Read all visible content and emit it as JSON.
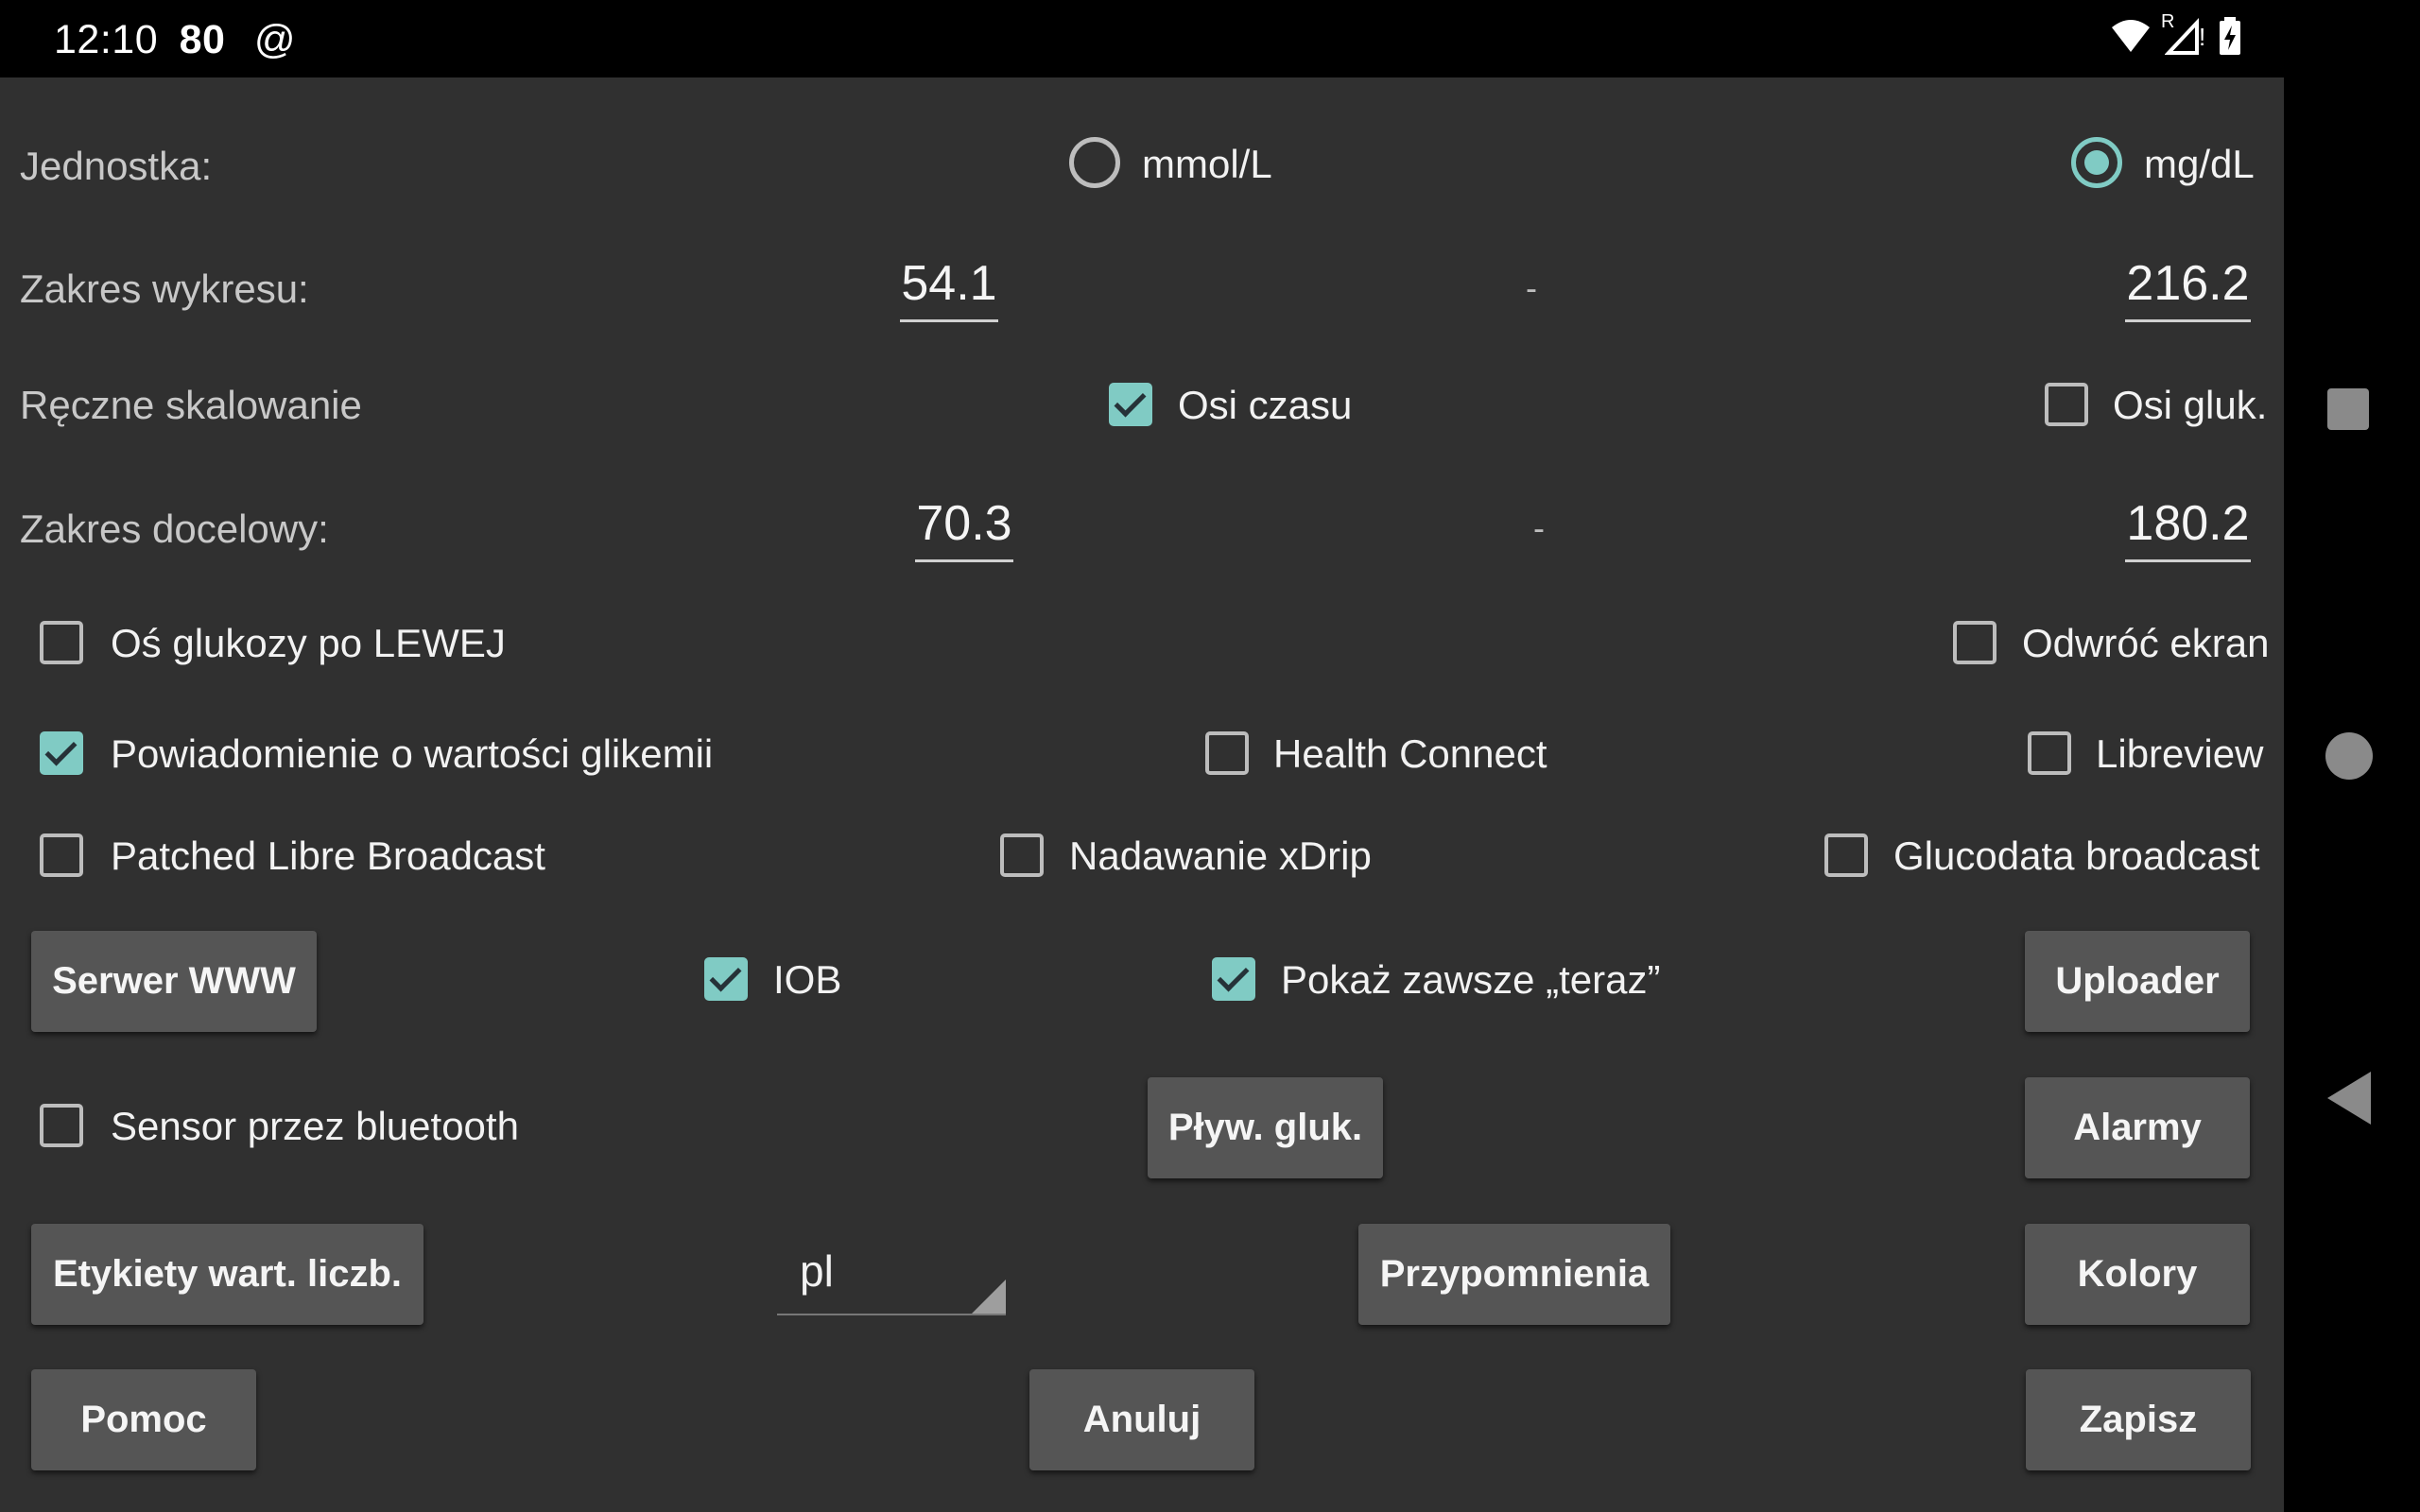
{
  "status_bar": {
    "time": "12:10",
    "battery_value": "80",
    "at_symbol": "@",
    "roaming_mark": "R",
    "alert_mark": "!"
  },
  "settings": {
    "unit": {
      "label": "Jednostka:",
      "option_mmol": "mmol/L",
      "option_mgdl": "mg/dL",
      "selected": "mg/dL"
    },
    "graph_range": {
      "label": "Zakres wykresu:",
      "min": "54.1",
      "max": "216.2",
      "separator": "-"
    },
    "manual_scaling": {
      "label": "Ręczne skalowanie",
      "time_axis": "Osi czasu",
      "time_axis_checked": true,
      "gluc_axis": "Osi gluk.",
      "gluc_axis_checked": false
    },
    "target_range": {
      "label": "Zakres docelowy:",
      "min": "70.3",
      "max": "180.2",
      "separator": "-"
    },
    "glucose_axis_left": {
      "label": "Oś glukozy po LEWEJ",
      "checked": false
    },
    "flip_screen": {
      "label": "Odwróć ekran",
      "checked": false
    },
    "glycemia_notification": {
      "label": "Powiadomienie o wartości glikemii",
      "checked": true
    },
    "health_connect": {
      "label": "Health Connect",
      "checked": false
    },
    "libreview": {
      "label": "Libreview",
      "checked": false
    },
    "patched_libre_broadcast": {
      "label": "Patched Libre Broadcast",
      "checked": false
    },
    "xdrip_broadcast": {
      "label": "Nadawanie xDrip",
      "checked": false
    },
    "glucodata_broadcast": {
      "label": "Glucodata broadcast",
      "checked": false
    },
    "iob": {
      "label": "IOB",
      "checked": true
    },
    "show_now": {
      "label": "Pokaż zawsze „teraz”",
      "checked": true
    },
    "sensor_bluetooth": {
      "label": "Sensor przez bluetooth",
      "checked": false
    },
    "language": {
      "value": "pl"
    }
  },
  "buttons": {
    "web_server": "Serwer WWW",
    "uploader": "Uploader",
    "floating_glucose": "Pływ. gluk.",
    "alarms": "Alarmy",
    "numeric_labels": "Etykiety wart. liczb.",
    "reminders": "Przypomnienia",
    "colors": "Kolory",
    "help": "Pomoc",
    "cancel": "Anuluj",
    "save": "Zapisz"
  },
  "nav_bar": {
    "icons": [
      "recents-square-icon",
      "home-circle-icon",
      "back-triangle-icon"
    ]
  },
  "colors": {
    "accent": "#80cbc4",
    "background": "#303030",
    "button": "#555555"
  }
}
